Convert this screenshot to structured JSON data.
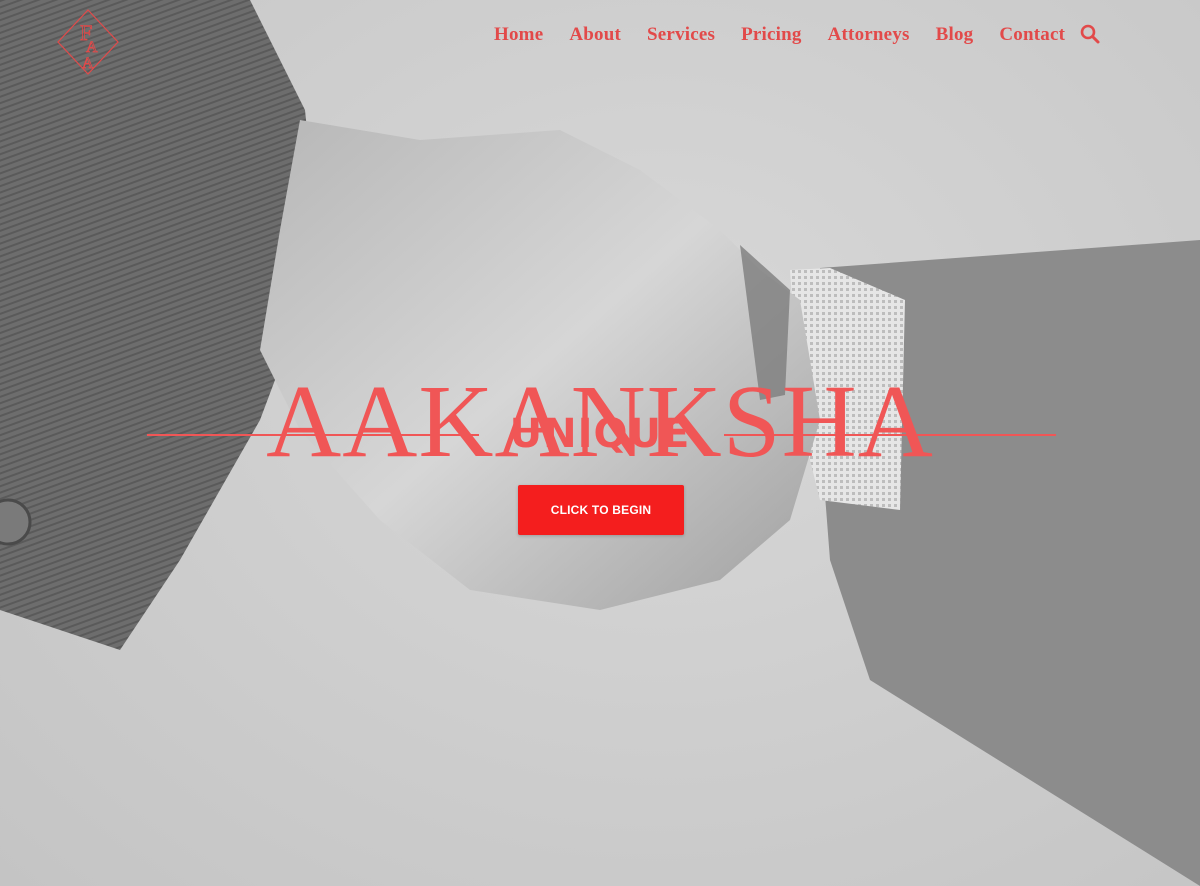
{
  "brand": {
    "logo_letters": "FAA",
    "accent_color": "#f05656"
  },
  "nav": {
    "items": [
      "Home",
      "About",
      "Services",
      "Pricing",
      "Attorneys",
      "Blog",
      "Contact"
    ]
  },
  "hero": {
    "title": "AAKANKSHA",
    "subtitle": "UNIQUE",
    "cta_label": "CLICK TO BEGIN",
    "background_image": "handshake-photo"
  },
  "icons": {
    "search": "search-icon",
    "logo": "diamond-monogram-logo"
  }
}
